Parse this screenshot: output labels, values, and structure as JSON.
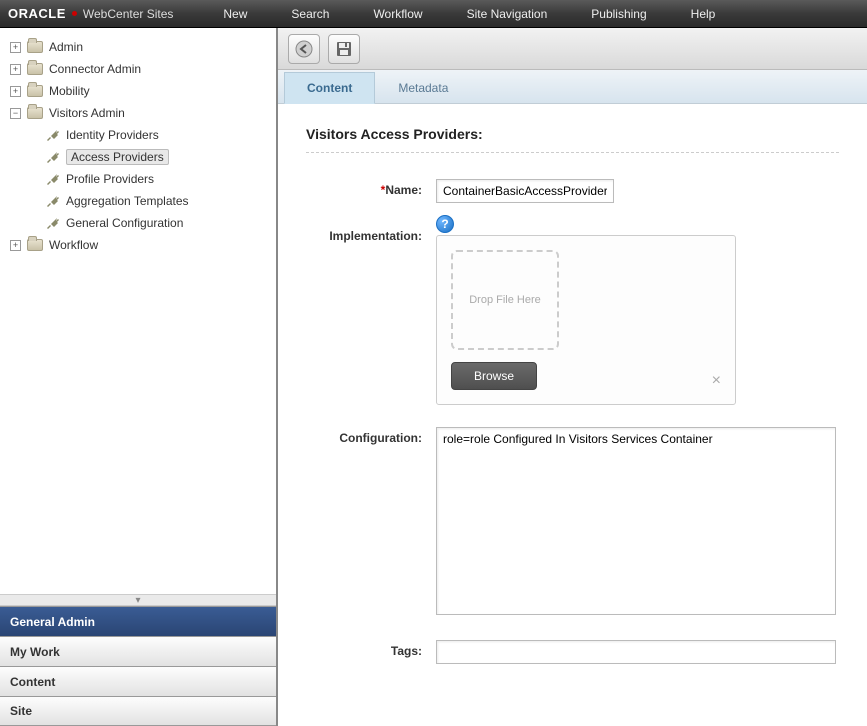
{
  "brand": {
    "oracle": "ORACLE",
    "product": "WebCenter Sites"
  },
  "topMenu": [
    "New",
    "Search",
    "Workflow",
    "Site Navigation",
    "Publishing",
    "Help"
  ],
  "tree": {
    "nodes": [
      {
        "label": "Admin",
        "expander": "+"
      },
      {
        "label": "Connector Admin",
        "expander": "+"
      },
      {
        "label": "Mobility",
        "expander": "+"
      },
      {
        "label": "Visitors Admin",
        "expander": "−",
        "children": [
          {
            "label": "Identity Providers"
          },
          {
            "label": "Access Providers",
            "selected": true
          },
          {
            "label": "Profile Providers"
          },
          {
            "label": "Aggregation Templates"
          },
          {
            "label": "General Configuration"
          }
        ]
      },
      {
        "label": "Workflow",
        "expander": "+"
      }
    ]
  },
  "sideNav": {
    "items": [
      "General Admin",
      "My Work",
      "Content",
      "Site"
    ],
    "activeIndex": 0
  },
  "tabs": {
    "items": [
      "Content",
      "Metadata"
    ],
    "activeIndex": 0
  },
  "page": {
    "title": "Visitors Access Providers:",
    "fields": {
      "nameLabel": "Name:",
      "nameValue": "ContainerBasicAccessProvider",
      "implLabel": "Implementation:",
      "dropText": "Drop File Here",
      "browseLabel": "Browse",
      "configLabel": "Configuration:",
      "configValue": "role=role Configured In Visitors Services Container",
      "tagsLabel": "Tags:",
      "tagsValue": ""
    }
  }
}
